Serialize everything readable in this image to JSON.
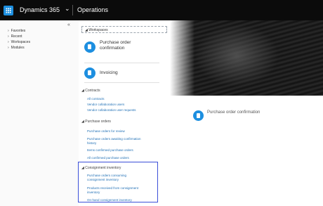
{
  "topbar": {
    "brand": "Dynamics 365",
    "chevron": "⌄",
    "app_name": "Operations"
  },
  "nav": {
    "collapse_icon": "«",
    "items": [
      {
        "label": "Favorites"
      },
      {
        "label": "Recent"
      },
      {
        "label": "Workspaces"
      },
      {
        "label": "Modules"
      }
    ]
  },
  "dashboard": {
    "header": "Workspaces",
    "tiles": [
      {
        "label": "Purchase order confirmation",
        "icon": "document-icon"
      },
      {
        "label": "Invoicing",
        "icon": "document-icon"
      }
    ],
    "sections": [
      {
        "title": "Contracts",
        "links": [
          "All contracts",
          "Vendor collaboration users",
          "Vendor collaboration user requests"
        ]
      },
      {
        "title": "Purchase orders",
        "links": [
          "Purchase orders for review",
          "Purchase orders awaiting confirmation history",
          "Items confirmed purchase orders",
          "All confirmed purchase orders"
        ]
      },
      {
        "title": "Consignment inventory",
        "links": [
          "Purchase orders consuming consignment inventory",
          "Products received from consignment inventory",
          "On-hand consignment inventory"
        ]
      }
    ]
  },
  "pinned": {
    "label": "Purchase order confirmation"
  },
  "colors": {
    "accent": "#1d8fe0",
    "link": "#1f6fb5",
    "highlight": "#3b4fd8",
    "topbar": "#0b0b0b"
  }
}
